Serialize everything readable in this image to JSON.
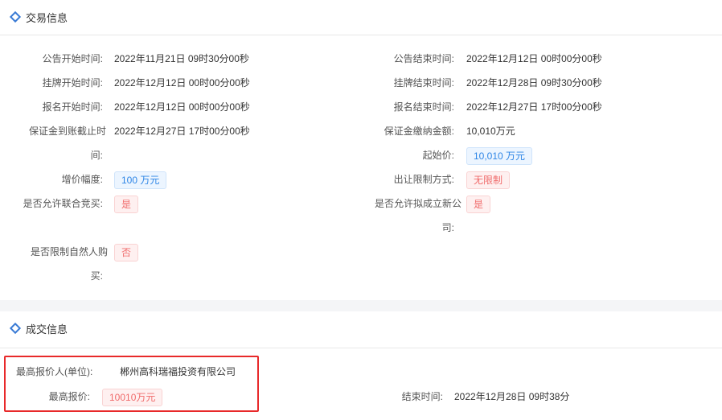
{
  "trade": {
    "title": "交易信息",
    "announce_start_label": "公告开始时间:",
    "announce_start_value": "2022年11月21日 09时30分00秒",
    "announce_end_label": "公告结束时间:",
    "announce_end_value": "2022年12月12日 00时00分00秒",
    "listing_start_label": "挂牌开始时间:",
    "listing_start_value": "2022年12月12日 00时00分00秒",
    "listing_end_label": "挂牌结束时间:",
    "listing_end_value": "2022年12月28日 09时30分00秒",
    "signup_start_label": "报名开始时间:",
    "signup_start_value": "2022年12月12日 00时00分00秒",
    "signup_end_label": "报名结束时间:",
    "signup_end_value": "2022年12月27日 17时00分00秒",
    "deposit_deadline_label_1": "保证金到账截止时",
    "deposit_deadline_label_2": "间:",
    "deposit_deadline_value": "2022年12月27日 17时00分00秒",
    "deposit_amount_label": "保证金缴纳金额:",
    "deposit_amount_value": "10,010万元",
    "start_price_label": "起始价:",
    "start_price_value": "10,010 万元",
    "increment_label": "增价幅度:",
    "increment_value": "100 万元",
    "restriction_label": "出让限制方式:",
    "restriction_value": "无限制",
    "joint_bid_label": "是否允许联合竞买:",
    "joint_bid_value": "是",
    "new_company_label_1": "是否允许拟成立新公",
    "new_company_label_2": "司:",
    "new_company_value": "是",
    "natural_person_label_1": "是否限制自然人购",
    "natural_person_label_2": "买:",
    "natural_person_value": "否"
  },
  "deal": {
    "title": "成交信息",
    "top_bidder_label": "最高报价人(单位):",
    "top_bidder_value": "郴州高科瑞福投资有限公司",
    "top_price_label": "最高报价:",
    "top_price_value": "10010万元",
    "end_time_label": "结束时间:",
    "end_time_value": "2022年12月28日 09时38分"
  },
  "colors": {
    "accent": "#3a7bd5",
    "tag_blue": "#2f86e6",
    "tag_red": "#f06b6b",
    "highlight_border": "#e8292a"
  },
  "icons": {
    "section_marker": "diamond-icon"
  }
}
